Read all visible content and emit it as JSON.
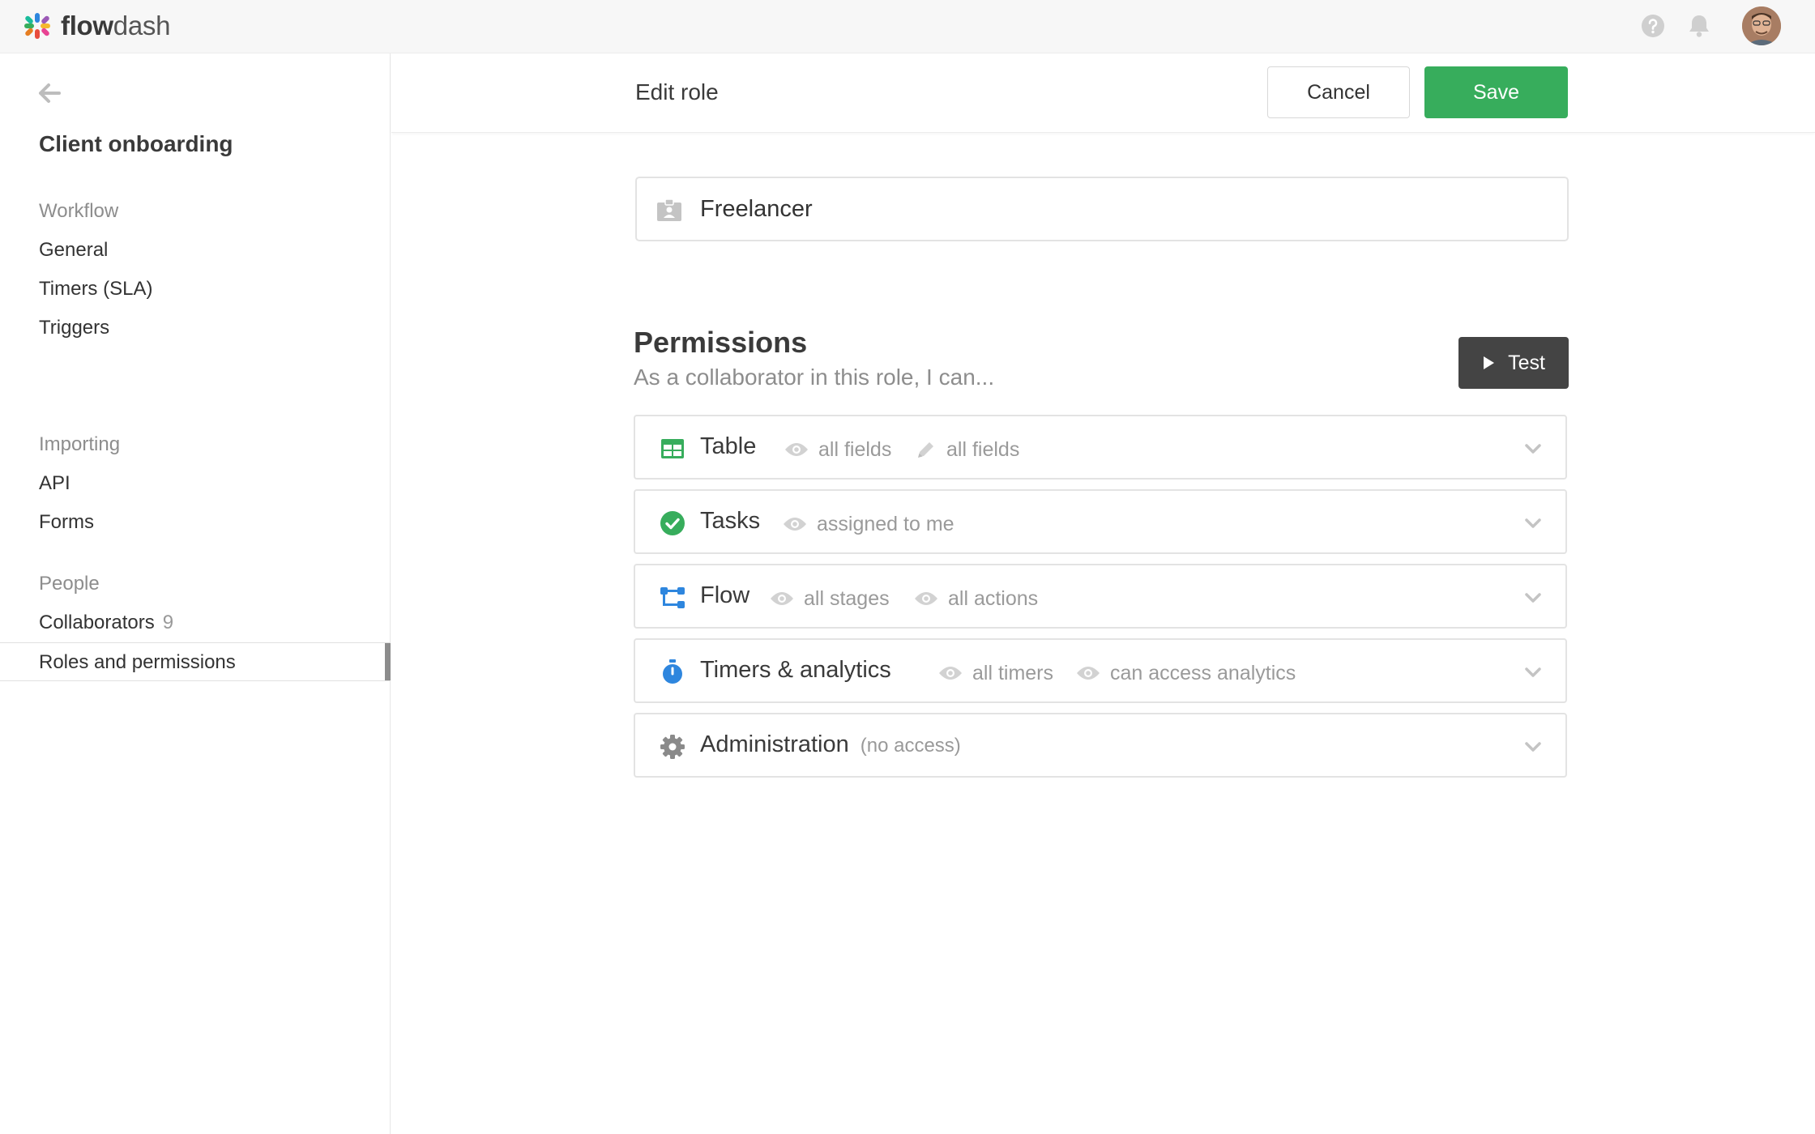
{
  "app": {
    "brand_bold": "flow",
    "brand_light": "dash",
    "icons": [
      "help-icon",
      "bell-icon",
      "user-avatar"
    ]
  },
  "sidebar": {
    "title": "Client onboarding",
    "groups": [
      {
        "heading": "Workflow",
        "items": [
          {
            "label": "General"
          },
          {
            "label": "Timers (SLA)"
          },
          {
            "label": "Triggers"
          }
        ]
      },
      {
        "heading": "Importing",
        "items": [
          {
            "label": "API"
          },
          {
            "label": "Forms"
          }
        ]
      },
      {
        "heading": "People",
        "items": [
          {
            "label": "Collaborators",
            "count": "9"
          },
          {
            "label": "Roles and permissions",
            "active": true
          }
        ]
      }
    ]
  },
  "header": {
    "title": "Edit role",
    "cancel_label": "Cancel",
    "save_label": "Save"
  },
  "role": {
    "name": "Freelancer"
  },
  "permissions": {
    "title": "Permissions",
    "subtitle": "As a collaborator in this role, I can...",
    "test_label": "Test",
    "rows": [
      {
        "name": "Table",
        "icon": "table-icon",
        "tags": [
          {
            "icon": "eye-icon",
            "text": "all fields"
          },
          {
            "icon": "pencil-icon",
            "text": "all fields"
          }
        ]
      },
      {
        "name": "Tasks",
        "icon": "check-circle-icon",
        "tags": [
          {
            "icon": "eye-icon",
            "text": "assigned to me"
          }
        ]
      },
      {
        "name": "Flow",
        "icon": "flow-icon",
        "tags": [
          {
            "icon": "eye-icon",
            "text": "all stages"
          },
          {
            "icon": "eye-icon",
            "text": "all actions"
          }
        ]
      },
      {
        "name": "Timers & analytics",
        "icon": "stopwatch-icon",
        "tags": [
          {
            "icon": "eye-icon",
            "text": "all timers"
          },
          {
            "icon": "eye-icon",
            "text": "can access analytics"
          }
        ]
      },
      {
        "name": "Administration",
        "icon": "gear-icon",
        "note": "(no access)",
        "tags": []
      }
    ]
  },
  "colors": {
    "save_green": "#37ad5c",
    "table_green": "#37ad5c",
    "flow_blue": "#2e86de",
    "test_dark": "#444444"
  }
}
